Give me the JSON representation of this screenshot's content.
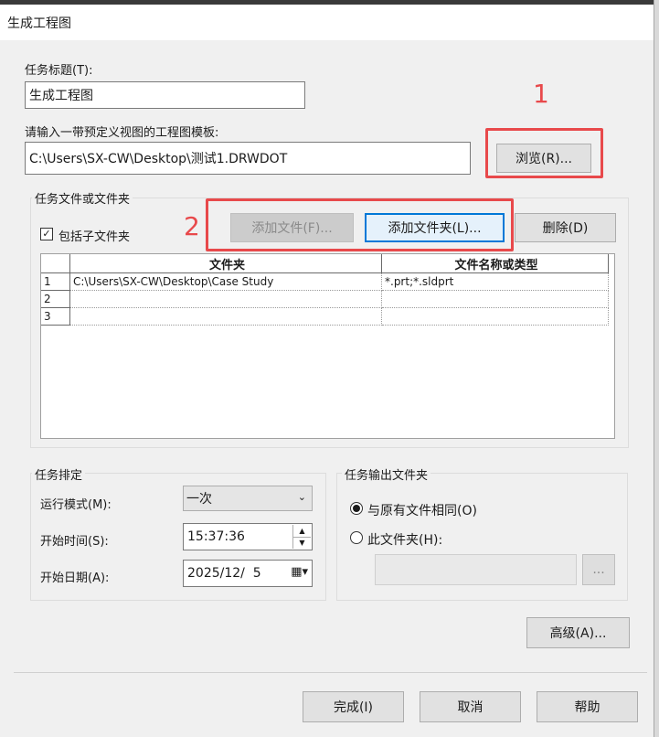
{
  "window": {
    "title": "生成工程图"
  },
  "task_title": {
    "label": "任务标题(T):",
    "value": "生成工程图"
  },
  "template": {
    "label": "请输入一带预定义视图的工程图模板:",
    "value": "C:\\Users\\SX-CW\\Desktop\\测试1.DRWDOT",
    "browse": "浏览(R)..."
  },
  "files_group": {
    "title": "任务文件或文件夹",
    "include_subfolders": "包括子文件夹",
    "add_file": "添加文件(F)...",
    "add_folder": "添加文件夹(L)...",
    "delete": "删除(D)",
    "columns": [
      "文件夹",
      "文件名称或类型"
    ],
    "rows": [
      {
        "num": "1",
        "folder": "C:\\Users\\SX-CW\\Desktop\\Case Study",
        "type": "*.prt;*.sldprt"
      },
      {
        "num": "2",
        "folder": "",
        "type": ""
      },
      {
        "num": "3",
        "folder": "",
        "type": ""
      }
    ]
  },
  "schedule": {
    "title": "任务排定",
    "run_mode_label": "运行模式(M):",
    "run_mode_value": "一次",
    "start_time_label": "开始时间(S):",
    "start_time_value": "15:37:36",
    "start_date_label": "开始日期(A):",
    "start_date_value": "2025/12/  5"
  },
  "output": {
    "title": "任务输出文件夹",
    "same_as_original": "与原有文件相同(O)",
    "this_folder": "此文件夹(H):",
    "browse_small": "..."
  },
  "advanced": "高级(A)...",
  "footer": {
    "finish": "完成(I)",
    "cancel": "取消",
    "help": "帮助"
  },
  "annotations": [
    "1",
    "2"
  ],
  "colors": {
    "annotation": "#e8494b",
    "accent": "#0078d7"
  }
}
